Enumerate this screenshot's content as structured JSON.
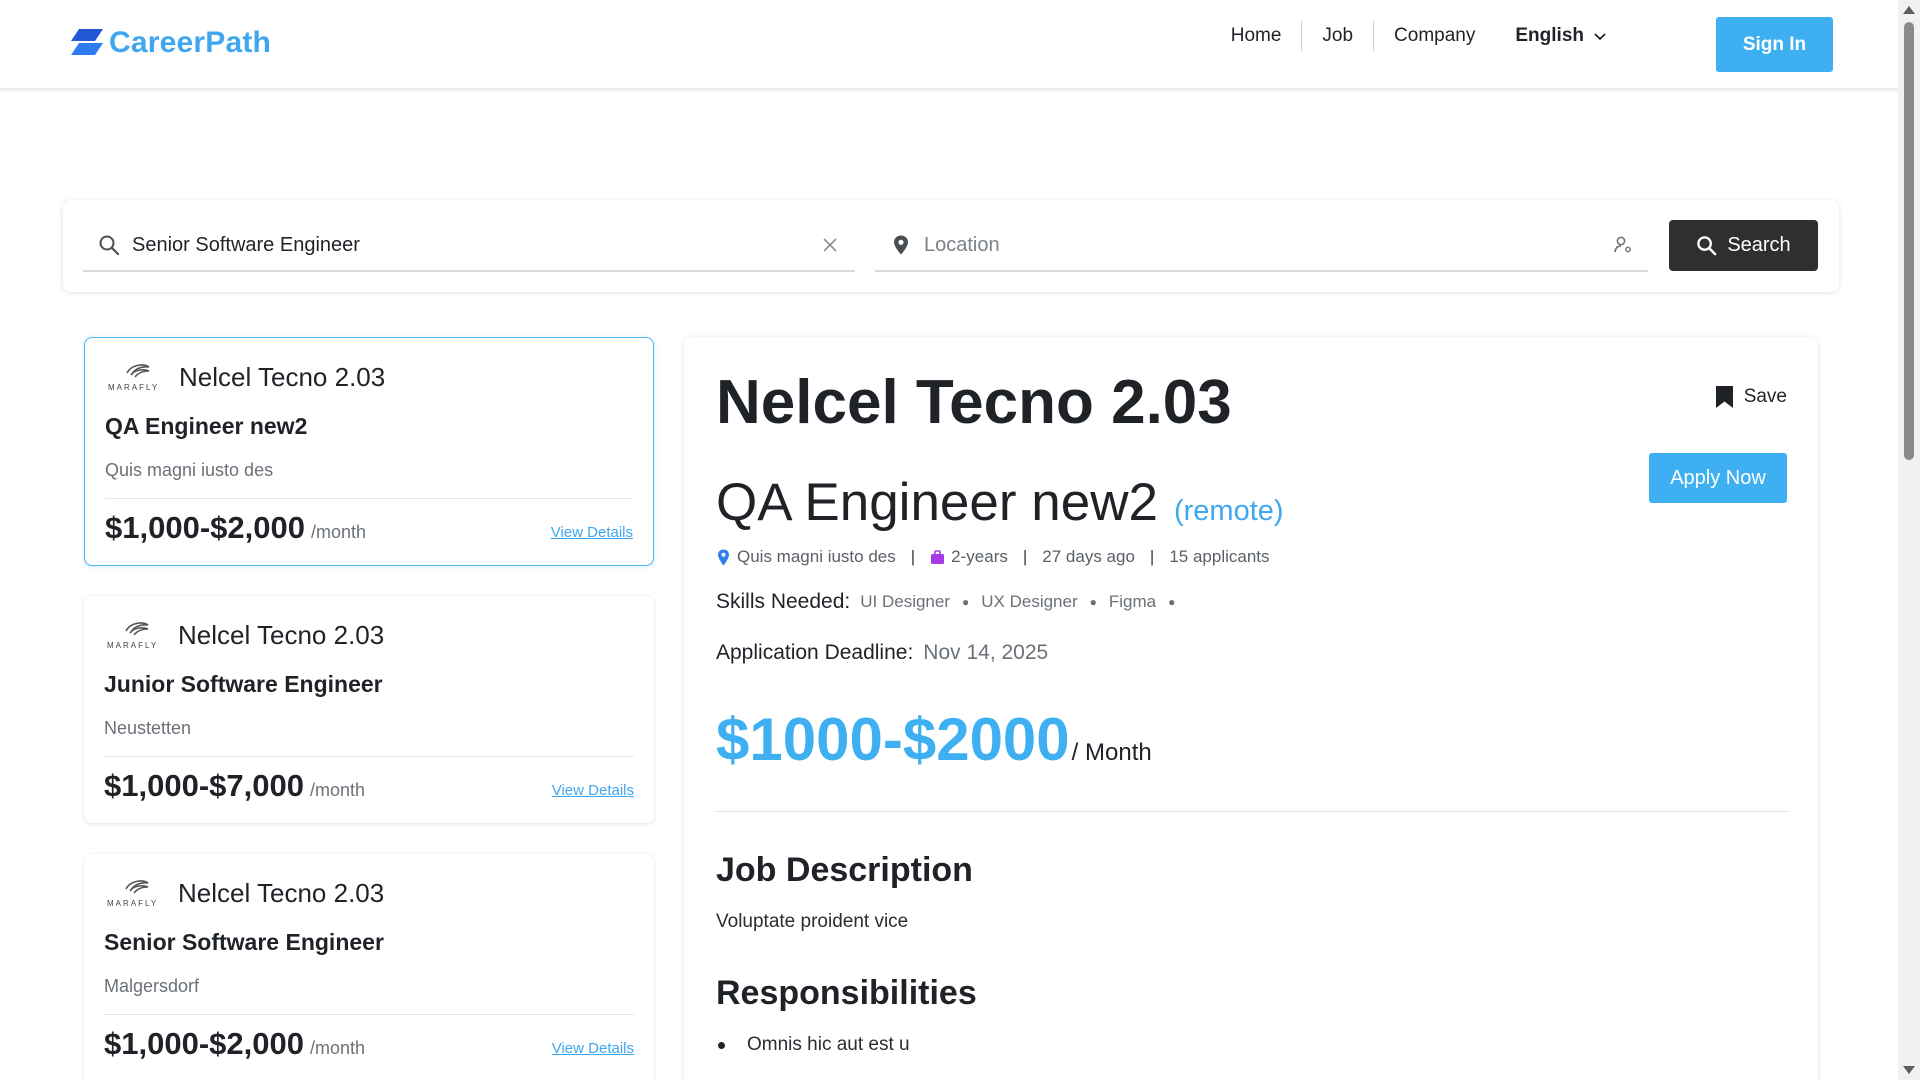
{
  "app": {
    "brand": "CareerPath",
    "colors": {
      "accent": "#3eb0f2",
      "dark": "#2f2f2f"
    }
  },
  "nav": {
    "items": [
      "Home",
      "Job",
      "Company"
    ],
    "language": "English",
    "signin_label": "Sign In"
  },
  "search": {
    "job_value": "Senior Software Engineer",
    "job_placeholder": "",
    "location_placeholder": "Location",
    "button_label": "Search",
    "icons": [
      "search-icon",
      "clear-icon",
      "location-pin-icon",
      "person-location-icon"
    ]
  },
  "jobs": [
    {
      "company": "Nelcel Tecno 2.03",
      "logo_text": "MARAFLY",
      "title": "QA Engineer new2",
      "location": "Quis magni iusto des",
      "salary": "$1,000-$2,000",
      "unit": "/month",
      "details_label": "View Details",
      "selected": true
    },
    {
      "company": "Nelcel Tecno 2.03",
      "logo_text": "MARAFLY",
      "title": "Junior Software Engineer",
      "location": "Neustetten",
      "salary": "$1,000-$7,000",
      "unit": "/month",
      "details_label": "View Details",
      "selected": false
    },
    {
      "company": "Nelcel Tecno 2.03",
      "logo_text": "MARAFLY",
      "title": "Senior Software Engineer",
      "location": "Malgersdorf",
      "salary": "$1,000-$2,000",
      "unit": "/month",
      "details_label": "View Details",
      "selected": false
    }
  ],
  "detail": {
    "company": "Nelcel Tecno 2.03",
    "save_label": "Save",
    "apply_label": "Apply Now",
    "title": "QA Engineer new2",
    "work_mode": "(remote)",
    "location": "Quis magni iusto des",
    "experience": "2-years",
    "posted": "27 days ago",
    "applicants": "15 applicants",
    "skills_label": "Skills Needed:",
    "skills": [
      "UI Designer",
      "UX Designer",
      "Figma"
    ],
    "deadline_label": "Application Deadline:",
    "deadline": "Nov 14, 2025",
    "salary": "$1000-$2000",
    "salary_unit": "/ Month",
    "description_heading": "Job Description",
    "description": "Voluptate proident vice",
    "responsibilities_heading": "Responsibilities",
    "responsibilities": [
      "Omnis hic aut est u"
    ]
  }
}
